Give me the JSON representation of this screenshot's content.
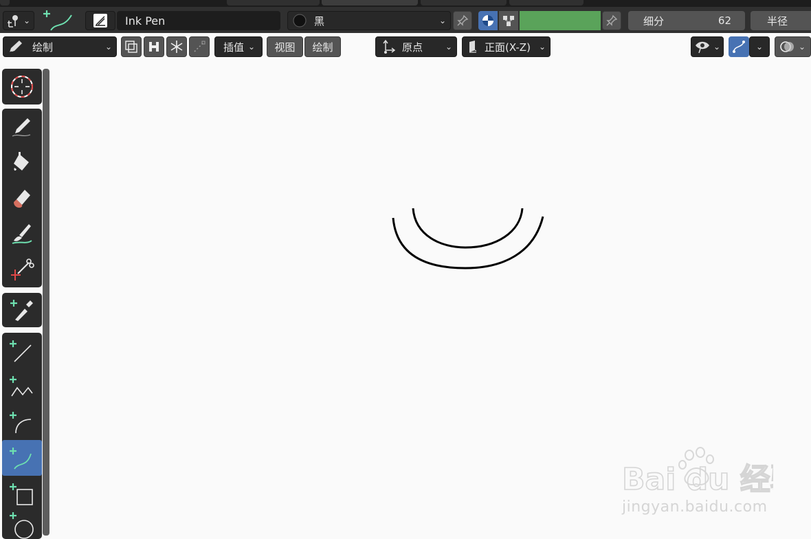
{
  "header_row1": {
    "brush_name": "Ink Pen",
    "material_name": "黑",
    "subdivision_label": "细分",
    "subdivision_value": "62",
    "radius_label": "半径",
    "color_swatch": "#5aa35a"
  },
  "header_row2": {
    "mode_label": "绘制",
    "interpolate_label": "插值",
    "view_label": "视图",
    "draw_label": "绘制",
    "origin_label": "原点",
    "orientation_label": "正面(X-Z)"
  },
  "toolbar": {
    "tools": [
      "cursor",
      "draw",
      "fill",
      "erase",
      "tint",
      "cutter",
      "eyedropper",
      "line",
      "polyline",
      "arc",
      "curve",
      "box",
      "circle"
    ],
    "active_tool": "curve"
  },
  "watermark": {
    "logo_text": "Bai du 经验",
    "url_text": "jingyan.baidu.com"
  },
  "colors": {
    "accent": "#4772b3",
    "tool_icon": "#e0e0e0",
    "tool_green": "#6ee0b0",
    "stroke": "#000000"
  }
}
